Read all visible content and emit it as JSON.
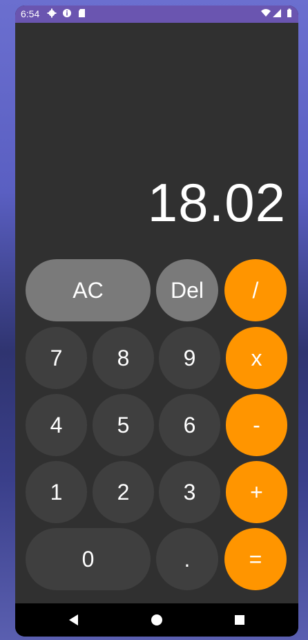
{
  "status_bar": {
    "time": "6:54",
    "left_icons": [
      "gear-icon",
      "info-icon",
      "sd-card-icon"
    ],
    "right_icons": [
      "wifi-icon",
      "signal-icon",
      "battery-icon"
    ],
    "color": "#6a55b0"
  },
  "display": {
    "value": "18.02"
  },
  "keypad": {
    "rows": [
      [
        {
          "label": "AC",
          "kind": "util"
        },
        {
          "label": "Del",
          "kind": "util"
        },
        {
          "label": "/",
          "kind": "op"
        }
      ],
      [
        {
          "label": "7",
          "kind": "num"
        },
        {
          "label": "8",
          "kind": "num"
        },
        {
          "label": "9",
          "kind": "num"
        },
        {
          "label": "x",
          "kind": "op"
        }
      ],
      [
        {
          "label": "4",
          "kind": "num"
        },
        {
          "label": "5",
          "kind": "num"
        },
        {
          "label": "6",
          "kind": "num"
        },
        {
          "label": "-",
          "kind": "op"
        }
      ],
      [
        {
          "label": "1",
          "kind": "num"
        },
        {
          "label": "2",
          "kind": "num"
        },
        {
          "label": "3",
          "kind": "num"
        },
        {
          "label": "+",
          "kind": "op"
        }
      ],
      [
        {
          "label": "0",
          "kind": "num"
        },
        {
          "label": ".",
          "kind": "num"
        },
        {
          "label": "=",
          "kind": "op"
        }
      ]
    ]
  },
  "colors": {
    "operator": "#ff9500",
    "number": "#3f3f3f",
    "utility": "#7a7a7a",
    "background": "#303030"
  },
  "nav_bar": {
    "icons": [
      "back-icon",
      "home-icon",
      "recents-icon"
    ]
  }
}
